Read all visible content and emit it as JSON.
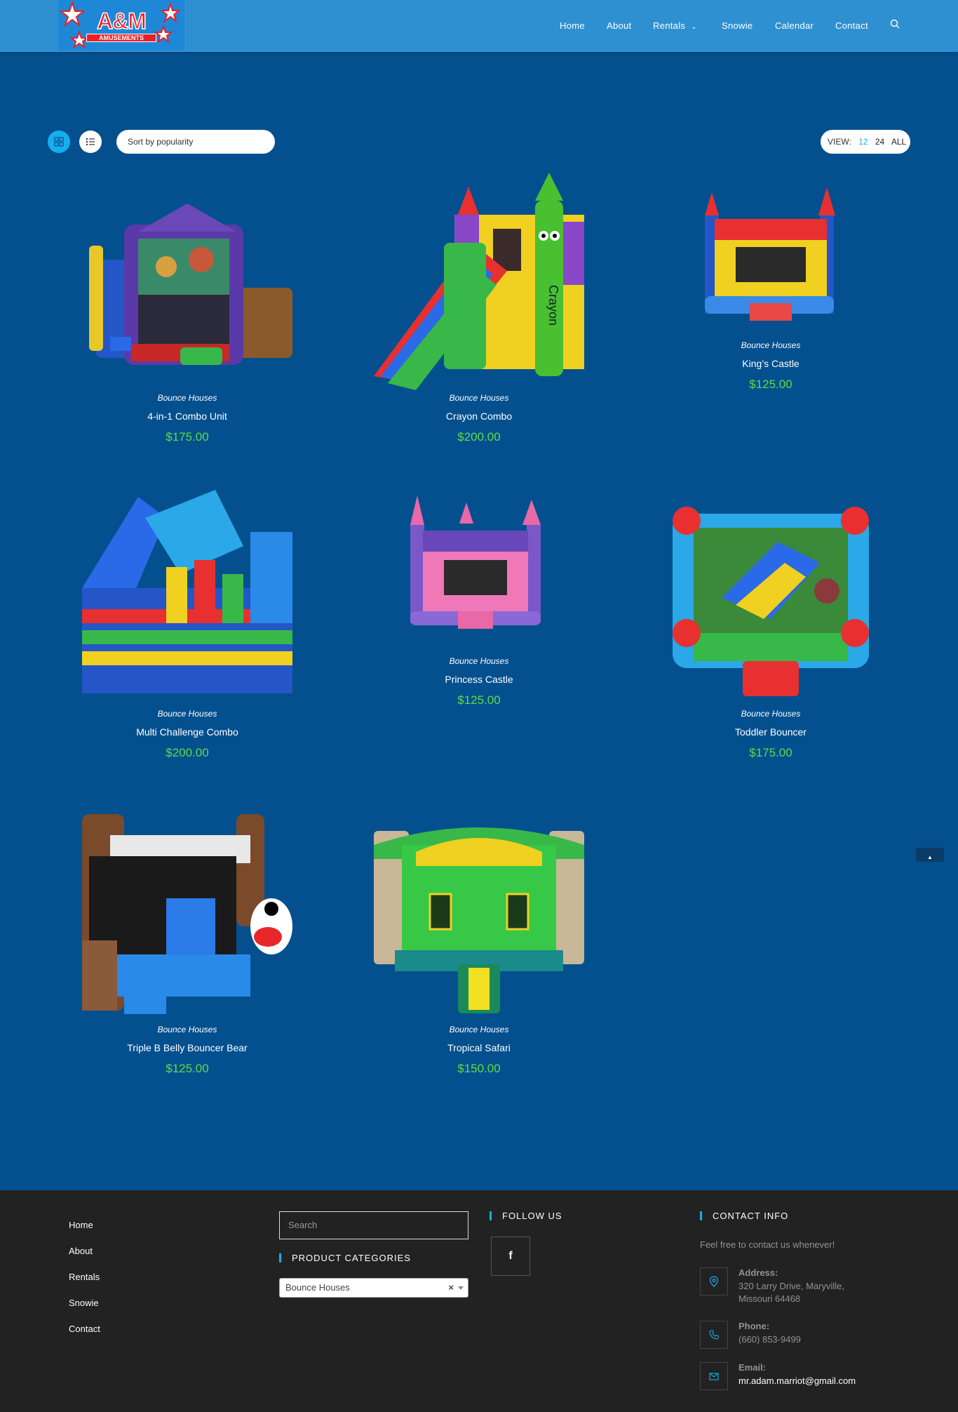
{
  "header": {
    "logo": {
      "main": "A&M",
      "sub": "AMUSEMENTS"
    },
    "nav": [
      "Home",
      "About",
      "Rentals",
      "Snowie",
      "Calendar",
      "Contact"
    ]
  },
  "toolbar": {
    "sort_label": "Sort by popularity",
    "view_label": "VIEW:",
    "view_options": [
      "12",
      "24",
      "ALL"
    ],
    "active_view": "12"
  },
  "products": [
    {
      "category": "Bounce Houses",
      "title": "4-in-1 Combo Unit",
      "price": "$175.00"
    },
    {
      "category": "Bounce Houses",
      "title": "Crayon Combo",
      "price": "$200.00",
      "image_text": "Crayon"
    },
    {
      "category": "Bounce Houses",
      "title": "King’s Castle",
      "price": "$125.00"
    },
    {
      "category": "Bounce Houses",
      "title": "Multi Challenge Combo",
      "price": "$200.00"
    },
    {
      "category": "Bounce Houses",
      "title": "Princess Castle",
      "price": "$125.00"
    },
    {
      "category": "Bounce Houses",
      "title": "Toddler Bouncer",
      "price": "$175.00"
    },
    {
      "category": "Bounce Houses",
      "title": "Triple B Belly Bouncer Bear",
      "price": "$125.00"
    },
    {
      "category": "Bounce Houses",
      "title": "Tropical Safari",
      "price": "$150.00"
    }
  ],
  "footer": {
    "menu": [
      "Home",
      "About",
      "Rentals",
      "Snowie",
      "Contact"
    ],
    "search_placeholder": "Search",
    "product_categories_heading": "PRODUCT CATEGORIES",
    "category_selected": "Bounce Houses",
    "follow_heading": "FOLLOW US",
    "facebook_glyph": "f",
    "contact_heading": "CONTACT INFO",
    "contact_lead": "Feel free to contact us whenever!",
    "address_label": "Address:",
    "address_line1": "320 Larry Drive, Maryville,",
    "address_line2": "Missouri 64468",
    "phone_label": "Phone:",
    "phone": "(660) 853-9499",
    "email_label": "Email:",
    "email": "mr.adam.marriot@gmail.com"
  },
  "colors": {
    "header": "#2e90d1",
    "body": "#04508f",
    "accent": "#13aff0",
    "price": "#5fdc45",
    "footer": "#222222"
  }
}
